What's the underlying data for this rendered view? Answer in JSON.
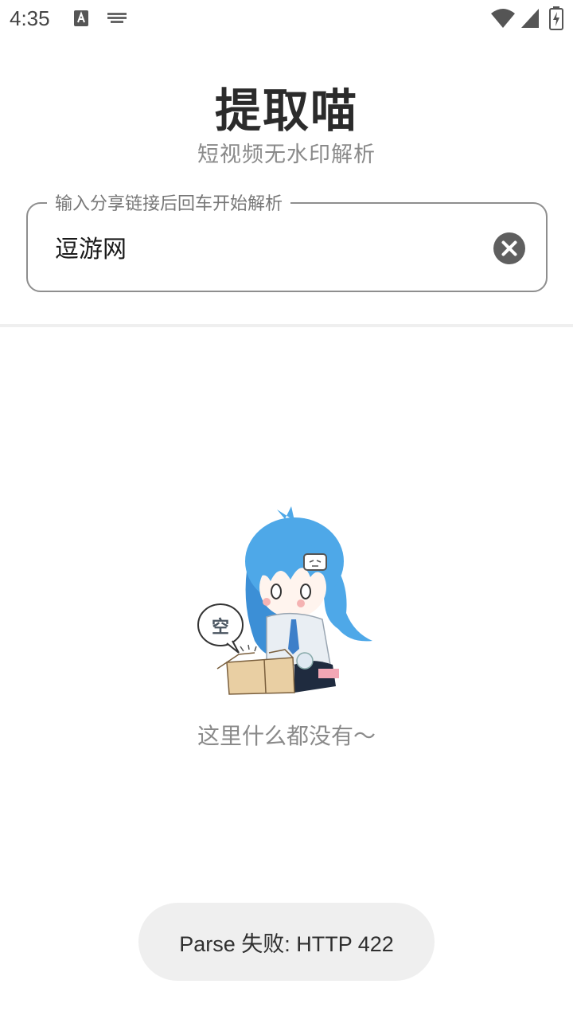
{
  "status_bar": {
    "time": "4:35",
    "icons": [
      "text-a-notification-icon",
      "keyboard-icon",
      "wifi-icon",
      "cellular-signal-icon",
      "battery-charging-icon"
    ]
  },
  "header": {
    "title": "提取喵",
    "subtitle": "短视频无水印解析"
  },
  "input": {
    "label": "输入分享链接后回车开始解析",
    "value": "逗游网",
    "clear_icon": "clear-circle-icon"
  },
  "empty_state": {
    "speech_bubble": "空",
    "message": "这里什么都没有～"
  },
  "toast": {
    "message": "Parse 失败: HTTP 422"
  },
  "colors": {
    "accent_hair": "#4ea8e8",
    "outline": "#8e8e8e",
    "toast_bg": "#efefef"
  }
}
